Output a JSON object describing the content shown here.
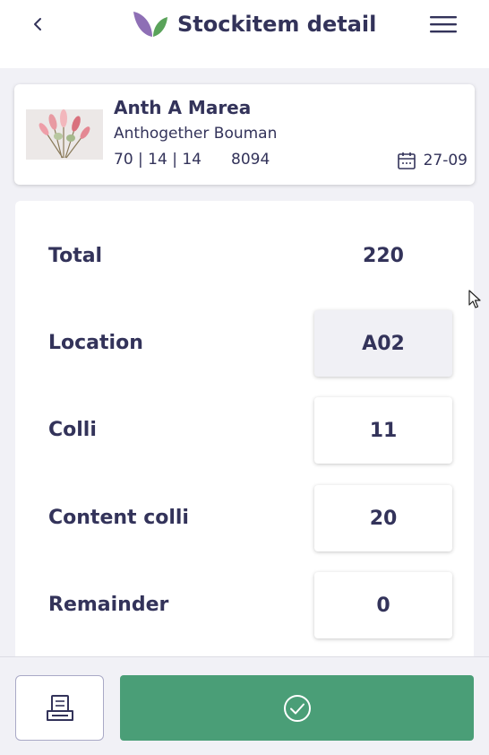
{
  "header": {
    "title": "Stockitem detail",
    "icons": {
      "back": "chevron-left-icon",
      "logo": "leaf-logo",
      "menu": "hamburger-menu-icon"
    }
  },
  "product": {
    "name": "Anth A Marea",
    "supplier": "Anthogether Bouman",
    "specs": "70 | 14 | 14",
    "code": "8094",
    "date": "27-09",
    "date_icon": "calendar-icon"
  },
  "details": {
    "total": {
      "label": "Total",
      "value": "220"
    },
    "location": {
      "label": "Location",
      "value": "A02"
    },
    "colli": {
      "label": "Colli",
      "value": "11"
    },
    "content_colli": {
      "label": "Content colli",
      "value": "20"
    },
    "remainder": {
      "label": "Remainder",
      "value": "0"
    }
  },
  "footer": {
    "print_icon": "printer-icon",
    "confirm_icon": "check-circle-icon"
  },
  "colors": {
    "text": "#33335a",
    "accent": "#4a9e77",
    "background": "#f1f1f6",
    "logo_purple": "#8e6fb5",
    "logo_green": "#5aa35a"
  }
}
